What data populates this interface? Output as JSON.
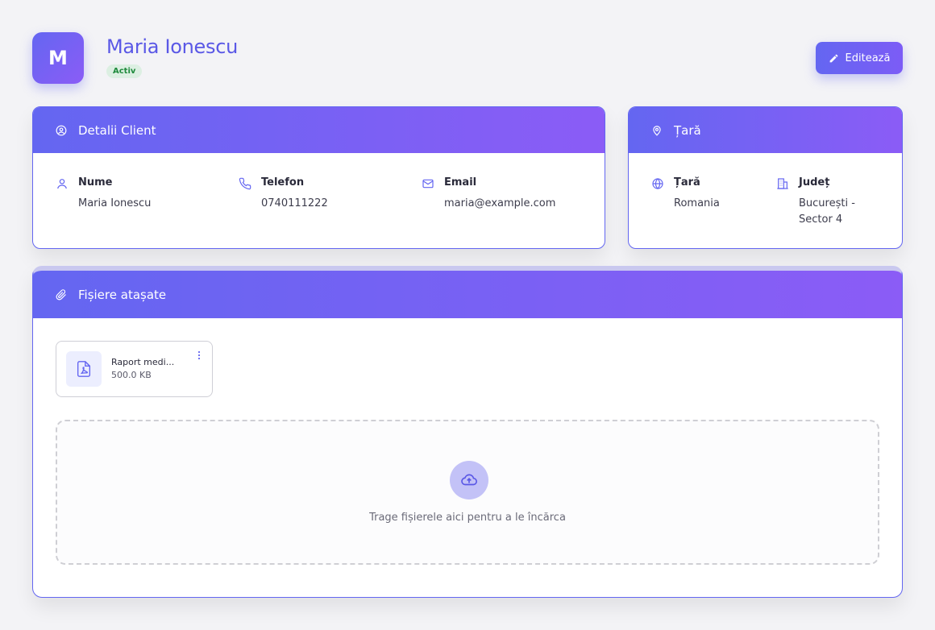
{
  "header": {
    "avatar_initial": "M",
    "client_name": "Maria Ionescu",
    "status": "Activ",
    "edit_label": "Editează"
  },
  "details_card": {
    "title": "Detalii Client",
    "fields": [
      {
        "label": "Nume",
        "value": "Maria Ionescu",
        "icon": "user-icon"
      },
      {
        "label": "Telefon",
        "value": "0740111222",
        "icon": "phone-icon"
      },
      {
        "label": "Email",
        "value": "maria@example.com",
        "icon": "mail-icon"
      }
    ]
  },
  "country_card": {
    "title": "Țară",
    "fields": [
      {
        "label": "Țară",
        "value": "Romania",
        "icon": "globe-icon"
      },
      {
        "label": "Județ",
        "value": "București - Sector 4",
        "icon": "building-icon"
      }
    ]
  },
  "files_card": {
    "title": "Fișiere atașate",
    "files": [
      {
        "name": "Raport medi...",
        "size": "500.0 KB",
        "icon": "pdf-icon"
      }
    ],
    "dropzone_text": "Trage fișierele aici pentru a le încărca"
  },
  "colors": {
    "accent": "#6466f1",
    "accent_end": "#8b5cf6",
    "status_bg": "#dcefe2",
    "status_text": "#1e8a3c"
  }
}
